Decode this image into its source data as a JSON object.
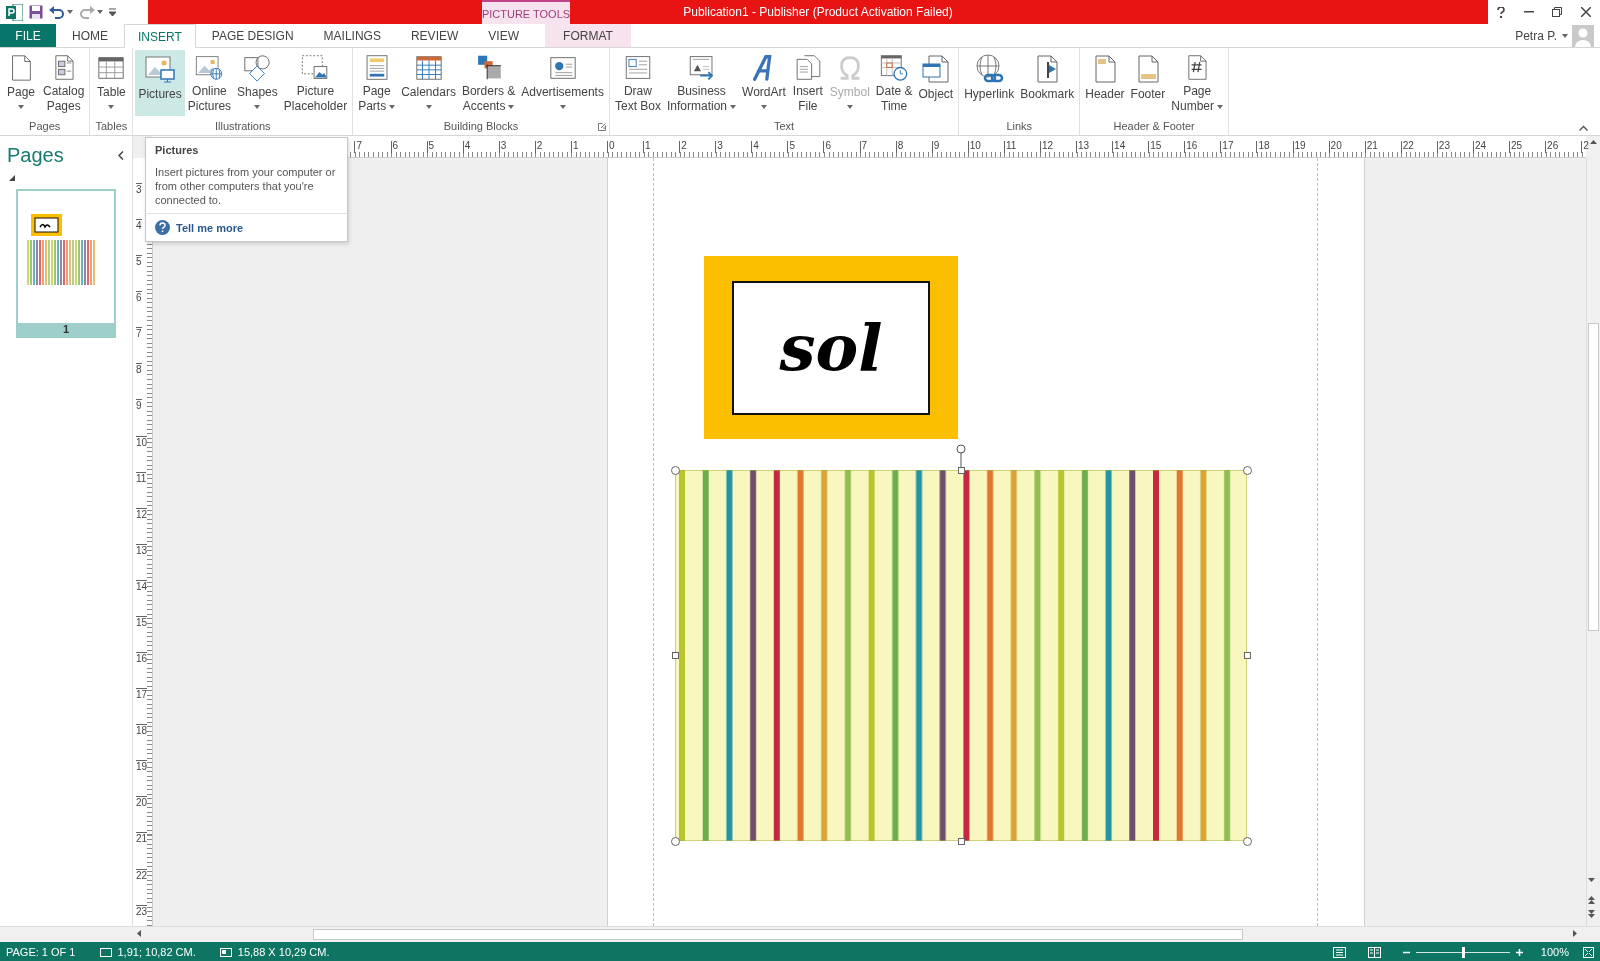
{
  "title_bar": {
    "title": "Publication1 -  Publisher (Product Activation Failed)",
    "contextual_label": "PICTURE TOOLS"
  },
  "account": {
    "name": "Petra P."
  },
  "tabs": [
    {
      "label": "FILE",
      "kind": "file",
      "selected": false
    },
    {
      "label": "HOME",
      "kind": "normal",
      "selected": false
    },
    {
      "label": "INSERT",
      "kind": "normal",
      "selected": true
    },
    {
      "label": "PAGE DESIGN",
      "kind": "normal",
      "selected": false
    },
    {
      "label": "MAILINGS",
      "kind": "normal",
      "selected": false
    },
    {
      "label": "REVIEW",
      "kind": "normal",
      "selected": false
    },
    {
      "label": "VIEW",
      "kind": "normal",
      "selected": false
    },
    {
      "label": "FORMAT",
      "kind": "contextual",
      "selected": false
    }
  ],
  "ribbon": {
    "groups": [
      {
        "label": "Pages",
        "launcher": false,
        "buttons": [
          {
            "lines": [
              "Page"
            ],
            "dropdown": true,
            "selected": false,
            "disabled": false
          },
          {
            "lines": [
              "Catalog",
              "Pages"
            ],
            "dropdown": false,
            "selected": false,
            "disabled": false
          }
        ]
      },
      {
        "label": "Tables",
        "launcher": false,
        "buttons": [
          {
            "lines": [
              "Table"
            ],
            "dropdown": true,
            "selected": false,
            "disabled": false
          }
        ]
      },
      {
        "label": "Illustrations",
        "launcher": false,
        "buttons": [
          {
            "lines": [
              "Pictures"
            ],
            "dropdown": false,
            "selected": true,
            "disabled": false
          },
          {
            "lines": [
              "Online",
              "Pictures"
            ],
            "dropdown": false,
            "selected": false,
            "disabled": false
          },
          {
            "lines": [
              "Shapes"
            ],
            "dropdown": true,
            "selected": false,
            "disabled": false
          },
          {
            "lines": [
              "Picture",
              "Placeholder"
            ],
            "dropdown": false,
            "selected": false,
            "disabled": false
          }
        ]
      },
      {
        "label": "Building Blocks",
        "launcher": true,
        "buttons": [
          {
            "lines": [
              "Page",
              "Parts"
            ],
            "dropdown": true,
            "selected": false,
            "disabled": false
          },
          {
            "lines": [
              "Calendars"
            ],
            "dropdown": true,
            "selected": false,
            "disabled": false
          },
          {
            "lines": [
              "Borders &",
              "Accents"
            ],
            "dropdown": true,
            "selected": false,
            "disabled": false
          },
          {
            "lines": [
              "Advertisements"
            ],
            "dropdown": true,
            "selected": false,
            "disabled": false
          }
        ]
      },
      {
        "label": "Text",
        "launcher": false,
        "buttons": [
          {
            "lines": [
              "Draw",
              "Text Box"
            ],
            "dropdown": false,
            "selected": false,
            "disabled": false
          },
          {
            "lines": [
              "Business",
              "Information"
            ],
            "dropdown": true,
            "selected": false,
            "disabled": false
          },
          {
            "lines": [
              "WordArt"
            ],
            "dropdown": true,
            "selected": false,
            "disabled": false
          },
          {
            "lines": [
              "Insert",
              "File"
            ],
            "dropdown": false,
            "selected": false,
            "disabled": false
          },
          {
            "lines": [
              "Symbol"
            ],
            "dropdown": true,
            "selected": false,
            "disabled": true
          },
          {
            "lines": [
              "Date &",
              "Time"
            ],
            "dropdown": false,
            "selected": false,
            "disabled": false
          },
          {
            "lines": [
              "Object"
            ],
            "dropdown": false,
            "selected": false,
            "disabled": false
          }
        ]
      },
      {
        "label": "Links",
        "launcher": false,
        "buttons": [
          {
            "lines": [
              "Hyperlink"
            ],
            "dropdown": false,
            "selected": false,
            "disabled": false
          },
          {
            "lines": [
              "Bookmark"
            ],
            "dropdown": false,
            "selected": false,
            "disabled": false
          }
        ]
      },
      {
        "label": "Header & Footer",
        "launcher": false,
        "buttons": [
          {
            "lines": [
              "Header"
            ],
            "dropdown": false,
            "selected": false,
            "disabled": false
          },
          {
            "lines": [
              "Footer"
            ],
            "dropdown": false,
            "selected": false,
            "disabled": false
          },
          {
            "lines": [
              "Page",
              "Number"
            ],
            "dropdown": true,
            "selected": false,
            "disabled": false
          }
        ]
      }
    ]
  },
  "tooltip": {
    "title": "Pictures",
    "body": "Insert pictures from your computer or from other computers that you're connected to.",
    "link": "Tell me more"
  },
  "pages_panel": {
    "title": "Pages",
    "pages": [
      {
        "number": "1",
        "selected": true
      }
    ]
  },
  "rulers": {
    "horizontal": [
      "7",
      "6",
      "5",
      "4",
      "3",
      "2",
      "1",
      "0",
      "1",
      "2",
      "3",
      "4",
      "5",
      "6",
      "7",
      "8",
      "9",
      "10",
      "11",
      "12",
      "13",
      "14",
      "15",
      "16",
      "17",
      "18",
      "19",
      "20",
      "21",
      "22",
      "23",
      "24",
      "25",
      "26",
      "2"
    ],
    "vertical": [
      "3",
      "4",
      "5",
      "6",
      "7",
      "8",
      "9",
      "10",
      "11",
      "12",
      "13",
      "14",
      "15",
      "16",
      "17",
      "18",
      "19",
      "20",
      "21",
      "22",
      "23"
    ]
  },
  "document": {
    "text_box": "sol",
    "picture": {
      "kind": "picture",
      "selected": true
    }
  },
  "status_bar": {
    "page": "PAGE: 1 OF 1",
    "position": "1,91; 10,82 CM.",
    "size": "15,88 X  10,29 CM.",
    "zoom": "100%",
    "zoom_slider": {
      "level": 0.5
    }
  }
}
